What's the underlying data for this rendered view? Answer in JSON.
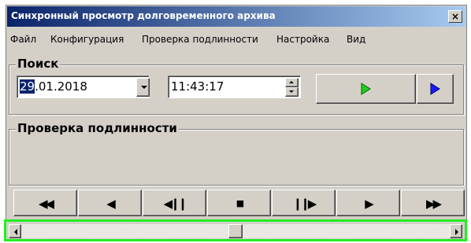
{
  "window": {
    "title": "Синхронный просмотр долговременного архива",
    "close_label": "×"
  },
  "menu": [
    "Файл",
    "Конфигурация",
    "Проверка подлинности",
    "Настройка",
    "Вид"
  ],
  "search": {
    "label": "Поиск",
    "date_selected": "29",
    "date_rest": ".01.2018",
    "time": "11:43:17"
  },
  "verify": {
    "label": "Проверка подлинности"
  },
  "colors": {
    "play_green": "#22cc22",
    "play_blue": "#1a1aff",
    "highlight": "#22ee22",
    "title_start": "#0a246a"
  },
  "playback": {
    "position_fraction": 0.5
  }
}
